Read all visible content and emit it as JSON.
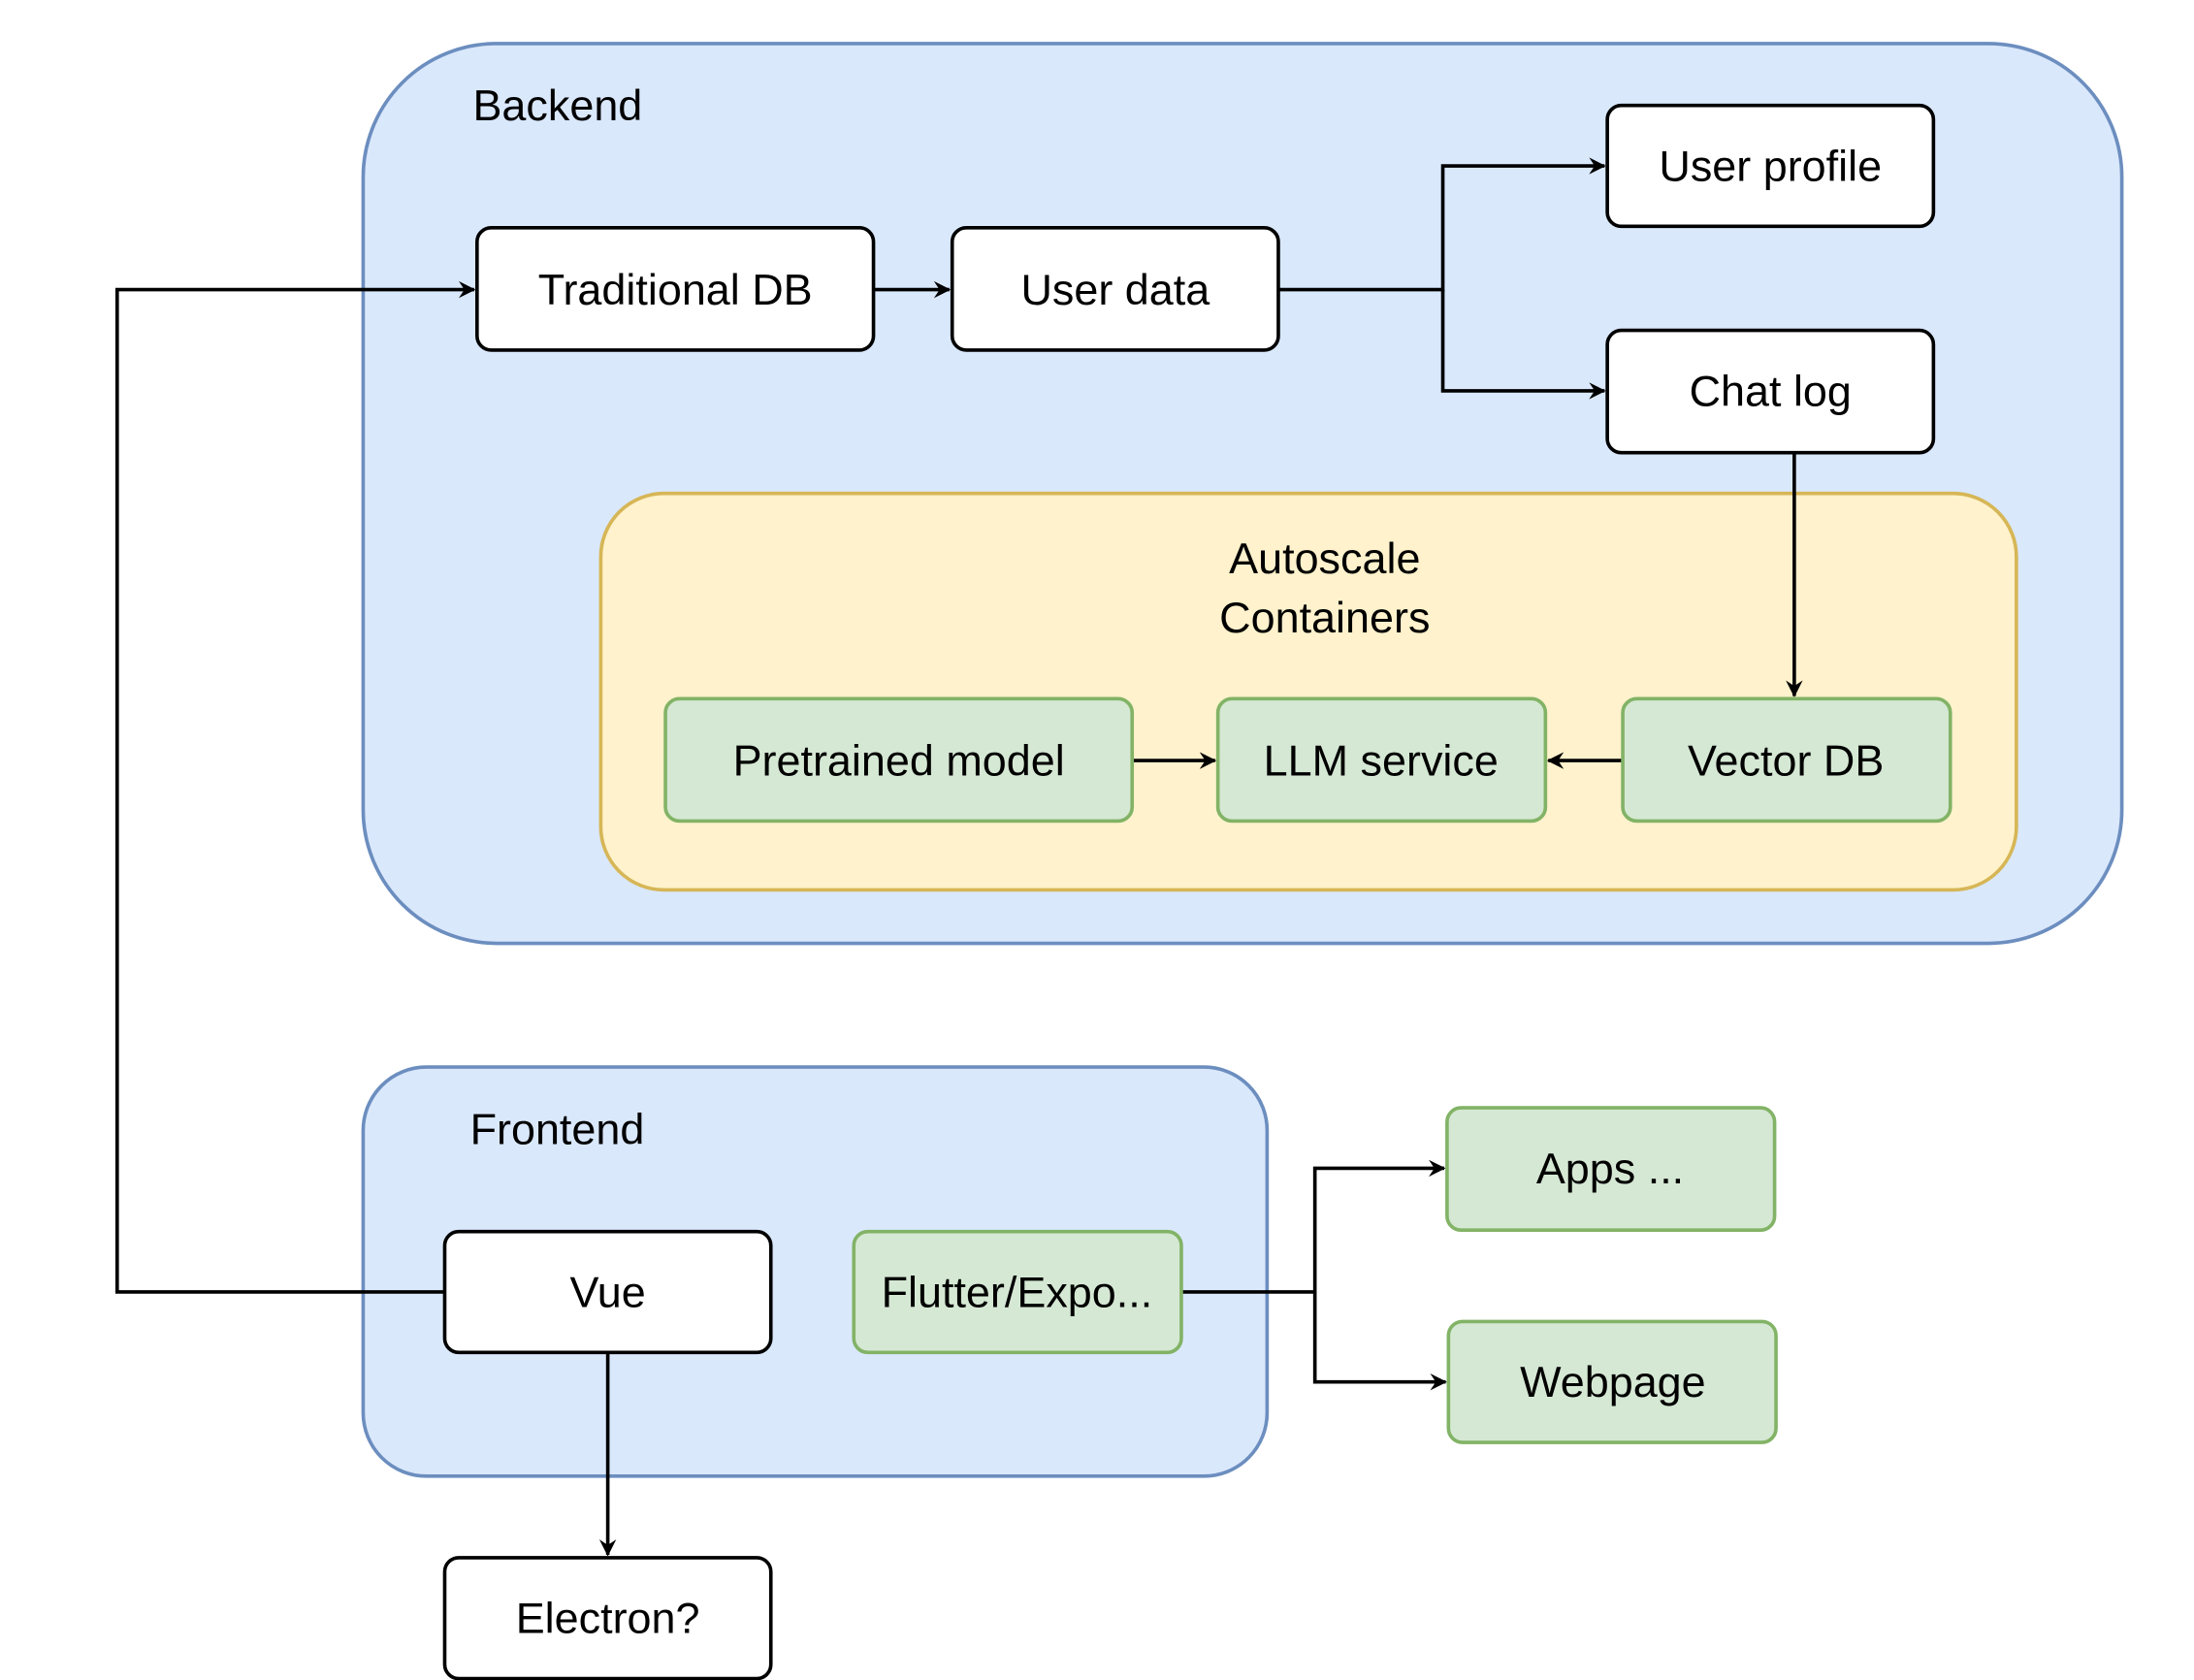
{
  "colors": {
    "group_fill": "#dae8fc",
    "group_stroke": "#6c8ebf",
    "container_fill": "#fff2cc",
    "container_stroke": "#d6b656",
    "service_fill": "#d5e8d4",
    "service_stroke": "#82b366"
  },
  "backend": {
    "label": "Backend",
    "nodes": {
      "traditional_db": "Traditional DB",
      "user_data": "User data",
      "user_profile": "User profile",
      "chat_log": "Chat log"
    },
    "autoscale": {
      "label_line1": "Autoscale",
      "label_line2": "Containers",
      "nodes": {
        "pretrained_model": "Pretrained model",
        "llm_service": "LLM service",
        "vector_db": "Vector DB"
      }
    }
  },
  "frontend": {
    "label": "Frontend",
    "nodes": {
      "vue": "Vue",
      "flutter": "Flutter/Expo..."
    }
  },
  "outputs": {
    "apps": "Apps ...",
    "webpage": "Webpage",
    "electron": "Electron?"
  },
  "edges": [
    [
      "Vue",
      "Traditional DB"
    ],
    [
      "Traditional DB",
      "User data"
    ],
    [
      "User data",
      "User profile"
    ],
    [
      "User data",
      "Chat log"
    ],
    [
      "Chat log",
      "Vector DB"
    ],
    [
      "Pretrained model",
      "LLM service"
    ],
    [
      "Vector DB",
      "LLM service"
    ],
    [
      "Flutter/Expo...",
      "Apps ..."
    ],
    [
      "Flutter/Expo...",
      "Webpage"
    ],
    [
      "Vue",
      "Electron?"
    ]
  ]
}
